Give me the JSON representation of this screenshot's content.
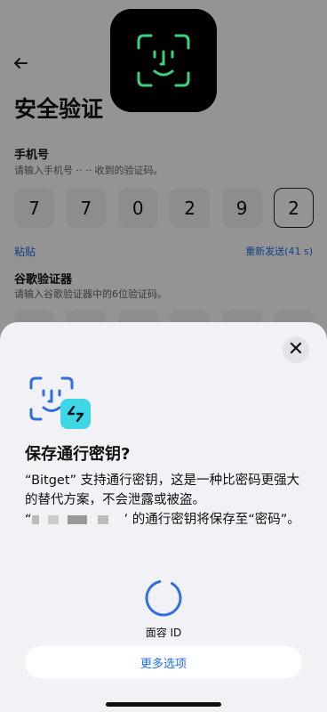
{
  "background": {
    "title": "安全验证",
    "phone_section": {
      "title": "手机号",
      "desc": "请输入手机号 ·· ·· 收到的验证码。",
      "digits": [
        "7",
        "7",
        "0",
        "2",
        "9",
        "2"
      ]
    },
    "paste_label": "粘贴",
    "resend_label": "重新发送(41 s)",
    "google_section": {
      "title": "谷歌验证器",
      "desc": "请输入谷歌验证器中的6位验证码。"
    }
  },
  "sheet": {
    "title": "保存通行密钥?",
    "body_line1": "“Bitget” 支持通行密钥，这是一种比密码更强大的替代方案，不会泄露或被盗。",
    "body_line2_quote_open": "“",
    "body_line2_rest": "’ 的通行密钥将保存至“密码”。",
    "faceid_label": "面容 ID",
    "more_options_label": "更多选项"
  },
  "colors": {
    "accent": "#1f6fe5",
    "faceid_green": "#3fd07a",
    "bitget_cyan": "#3fd6e6"
  },
  "icons": {
    "back": "back-arrow-icon",
    "close": "close-icon",
    "faceid": "faceid-icon",
    "bitget": "bitget-logo-icon",
    "spinner": "loading-spinner-icon"
  }
}
